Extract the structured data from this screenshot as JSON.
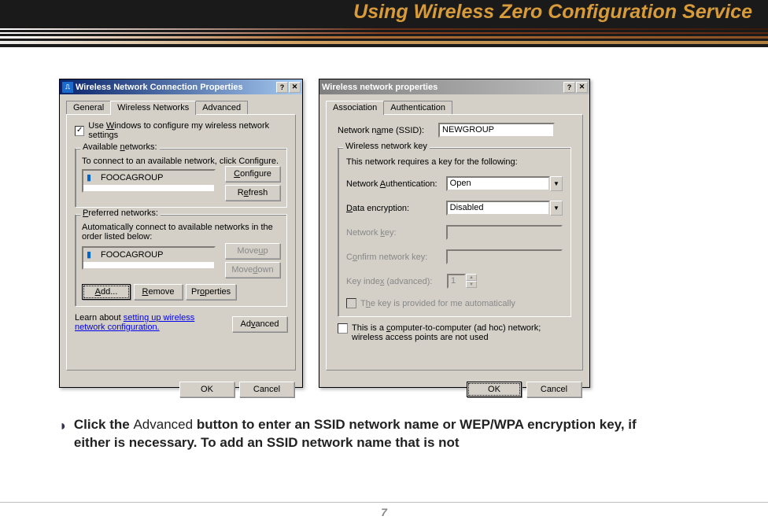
{
  "page": {
    "title": "Using Wireless Zero Configuration Service",
    "number": "7"
  },
  "instruction": {
    "prefix": "Click the ",
    "advanced_word": "Advanced",
    "rest": " button to enter an SSID network name or WEP/WPA encryption key, if either is necessary.  To add an SSID network name that is not"
  },
  "dlg1": {
    "title": "Wireless Network Connection Properties",
    "tabs": {
      "general": "General",
      "wireless": "Wireless Networks",
      "advanced": "Advanced"
    },
    "use_windows": "Use Windows to configure my wireless network settings",
    "use_windows_prefix": "Use ",
    "use_windows_u": "W",
    "use_windows_rest": "indows to configure my wireless network settings",
    "available": {
      "title_a": "Available ",
      "title_u": "n",
      "title_b": "etworks:",
      "hint": "To connect to an available network, click Configure.",
      "item": "FOOCAGROUP",
      "configure_u": "C",
      "configure_rest": "onfigure",
      "refresh_pre": "R",
      "refresh_u": "e",
      "refresh_rest": "fresh"
    },
    "preferred": {
      "title_u": "P",
      "title_rest": "referred networks:",
      "hint": "Automatically connect to available networks in the order listed below:",
      "item": "FOOCAGROUP",
      "moveup_a": "Move ",
      "moveup_u": "u",
      "moveup_b": "p",
      "movedn_a": "Move ",
      "movedn_u": "d",
      "movedn_b": "own",
      "add_u": "A",
      "add_rest": "dd...",
      "remove_u": "R",
      "remove_rest": "emove",
      "props_a": "Pr",
      "props_u": "o",
      "props_b": "perties"
    },
    "learn_a": "Learn about ",
    "learn_link": "setting up wireless network configuration.",
    "advanced_a": "Ad",
    "advanced_u": "v",
    "advanced_b": "anced",
    "ok": "OK",
    "cancel": "Cancel"
  },
  "dlg2": {
    "title": "Wireless network properties",
    "tabs": {
      "assoc": "Association",
      "auth": "Authentication"
    },
    "ssid_label_a": "Network n",
    "ssid_label_u": "a",
    "ssid_label_b": "me (SSID):",
    "ssid_value": "NEWGROUP",
    "key_group": "Wireless network key",
    "key_hint": "This network requires a key for the following:",
    "auth_label_a": "Network ",
    "auth_label_u": "A",
    "auth_label_b": "uthentication:",
    "auth_value": "Open",
    "enc_label_u": "D",
    "enc_label_rest": "ata encryption:",
    "enc_value": "Disabled",
    "netkey_a": "Network ",
    "netkey_u": "k",
    "netkey_b": "ey:",
    "confkey_a": "C",
    "confkey_u": "o",
    "confkey_b": "nfirm network key:",
    "keyidx_a": "Key inde",
    "keyidx_u": "x",
    "keyidx_b": " (advanced):",
    "keyidx_value": "1",
    "autokey_a": "T",
    "autokey_u": "h",
    "autokey_b": "e key is provided for me automatically",
    "adhoc_a": "This is a ",
    "adhoc_u": "c",
    "adhoc_b": "omputer-to-computer (ad hoc) network; wireless access points are not used",
    "ok": "OK",
    "cancel": "Cancel"
  }
}
